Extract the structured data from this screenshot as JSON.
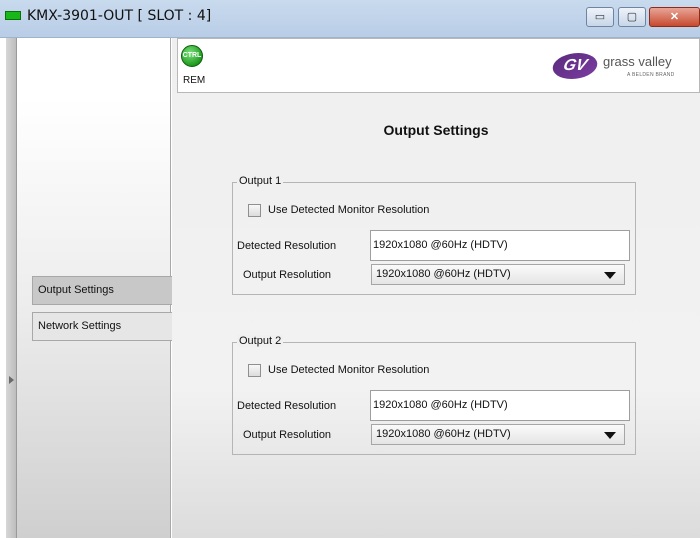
{
  "window": {
    "title": "KMX-3901-OUT [ SLOT : 4]",
    "min_glyph": "▭",
    "max_glyph": "▢",
    "close_glyph": "✕"
  },
  "sidebar": {
    "items": [
      {
        "label": "Output Settings",
        "selected": true
      },
      {
        "label": "Network Settings",
        "selected": false
      }
    ]
  },
  "header": {
    "ctrl_badge": "CTRL",
    "rem_label": "REM",
    "logo_mark": "GV",
    "logo_name": "grass valley",
    "logo_sub": "A BELDEN BRAND"
  },
  "page_title": "Output Settings",
  "outputs": [
    {
      "legend": "Output 1",
      "checkbox_label": "Use Detected Monitor Resolution",
      "checked": false,
      "detected_label": "Detected Resolution",
      "detected_value": "1920x1080 @60Hz (HDTV)",
      "output_label": "Output Resolution",
      "output_value": "1920x1080 @60Hz (HDTV)"
    },
    {
      "legend": "Output 2",
      "checkbox_label": "Use Detected Monitor Resolution",
      "checked": false,
      "detected_label": "Detected Resolution",
      "detected_value": "1920x1080 @60Hz (HDTV)",
      "output_label": "Output Resolution",
      "output_value": "1920x1080 @60Hz (HDTV)"
    }
  ],
  "colors": {
    "ctrl_green": "#1f9a1f",
    "brand_purple": "#5b2a7e",
    "close_red": "#c74a2f"
  }
}
